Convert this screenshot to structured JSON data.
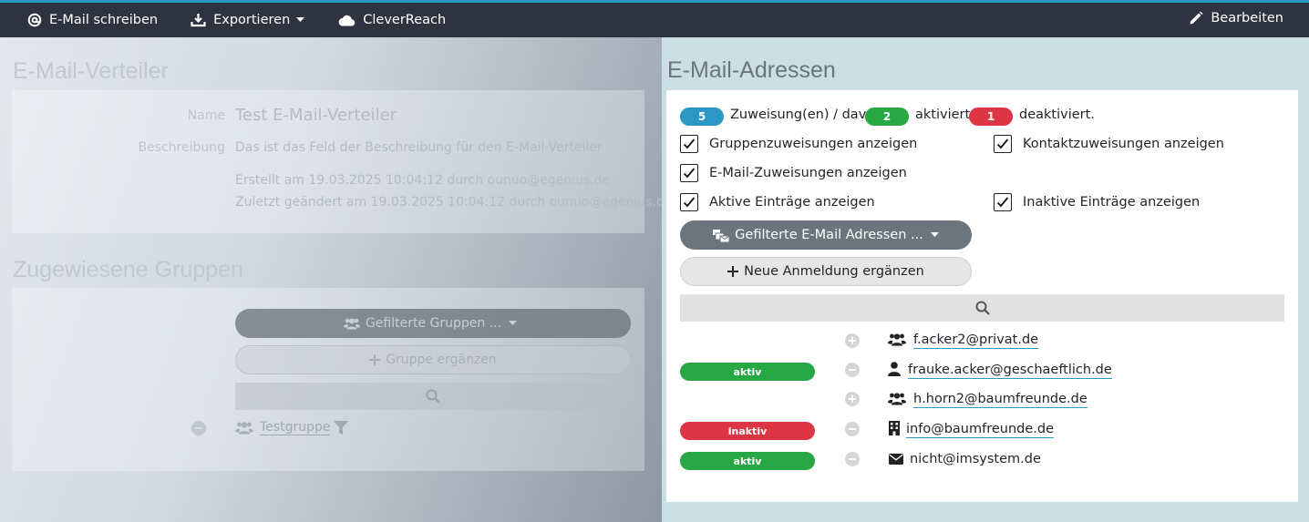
{
  "navbar": {
    "write_email": "E-Mail schreiben",
    "export": "Exportieren",
    "cleverreach": "CleverReach",
    "edit": "Bearbeiten"
  },
  "left_panel": {
    "title": "E-Mail-Verteiler",
    "name_label": "Name",
    "name_value": "Test E-Mail-Verteiler",
    "description_label": "Beschreibung",
    "description_value": "Das ist das Feld der Beschreibung für den E-Mail-Verteiler",
    "created": "Erstellt am 19.03.2025 10:04:12 durch ounuo@egenius.de",
    "modified": "Zuletzt geändert am 19.03.2025 10:04:12 durch ounuo@egenius.de",
    "groups_title": "Zugewiesene Gruppen",
    "filter_groups_button": "Gefilterte Gruppen ...",
    "add_group_button": "Gruppe ergänzen",
    "group_name": "Testgruppe"
  },
  "right_panel": {
    "title": "E-Mail-Adressen",
    "summary": {
      "total": "5",
      "total_text": "Zuweisung(en) / davon",
      "active": "2",
      "active_text": "aktiviert,",
      "inactive": "1",
      "inactive_text": "deaktiviert."
    },
    "checkboxes": {
      "group_assignments": "Gruppenzuweisungen anzeigen",
      "contact_assignments": "Kontaktzuweisungen anzeigen",
      "email_assignments": "E-Mail-Zuweisungen anzeigen",
      "active_entries": "Aktive Einträge anzeigen",
      "inactive_entries": "Inaktive Einträge anzeigen"
    },
    "filter_button": "Gefilterte E-Mail Adressen ...",
    "add_button": "Neue Anmeldung ergänzen",
    "entries": [
      {
        "status": "",
        "email": "f.acker2@privat.de",
        "icon": "users-icon"
      },
      {
        "status": "aktiv",
        "email": "frauke.acker@geschaeftlich.de",
        "icon": "user-icon"
      },
      {
        "status": "",
        "email": "h.horn2@baumfreunde.de",
        "icon": "users-icon"
      },
      {
        "status": "inaktiv",
        "email": "info@baumfreunde.de",
        "icon": "building-icon"
      },
      {
        "status": "aktiv",
        "email": "nicht@imsystem.de",
        "icon": "envelope-icon"
      }
    ]
  },
  "colors": {
    "navbar_bg": "#2f3340",
    "accent": "#2a97c4",
    "success": "#28a745",
    "danger": "#dc3545",
    "secondary": "#6c757d"
  }
}
